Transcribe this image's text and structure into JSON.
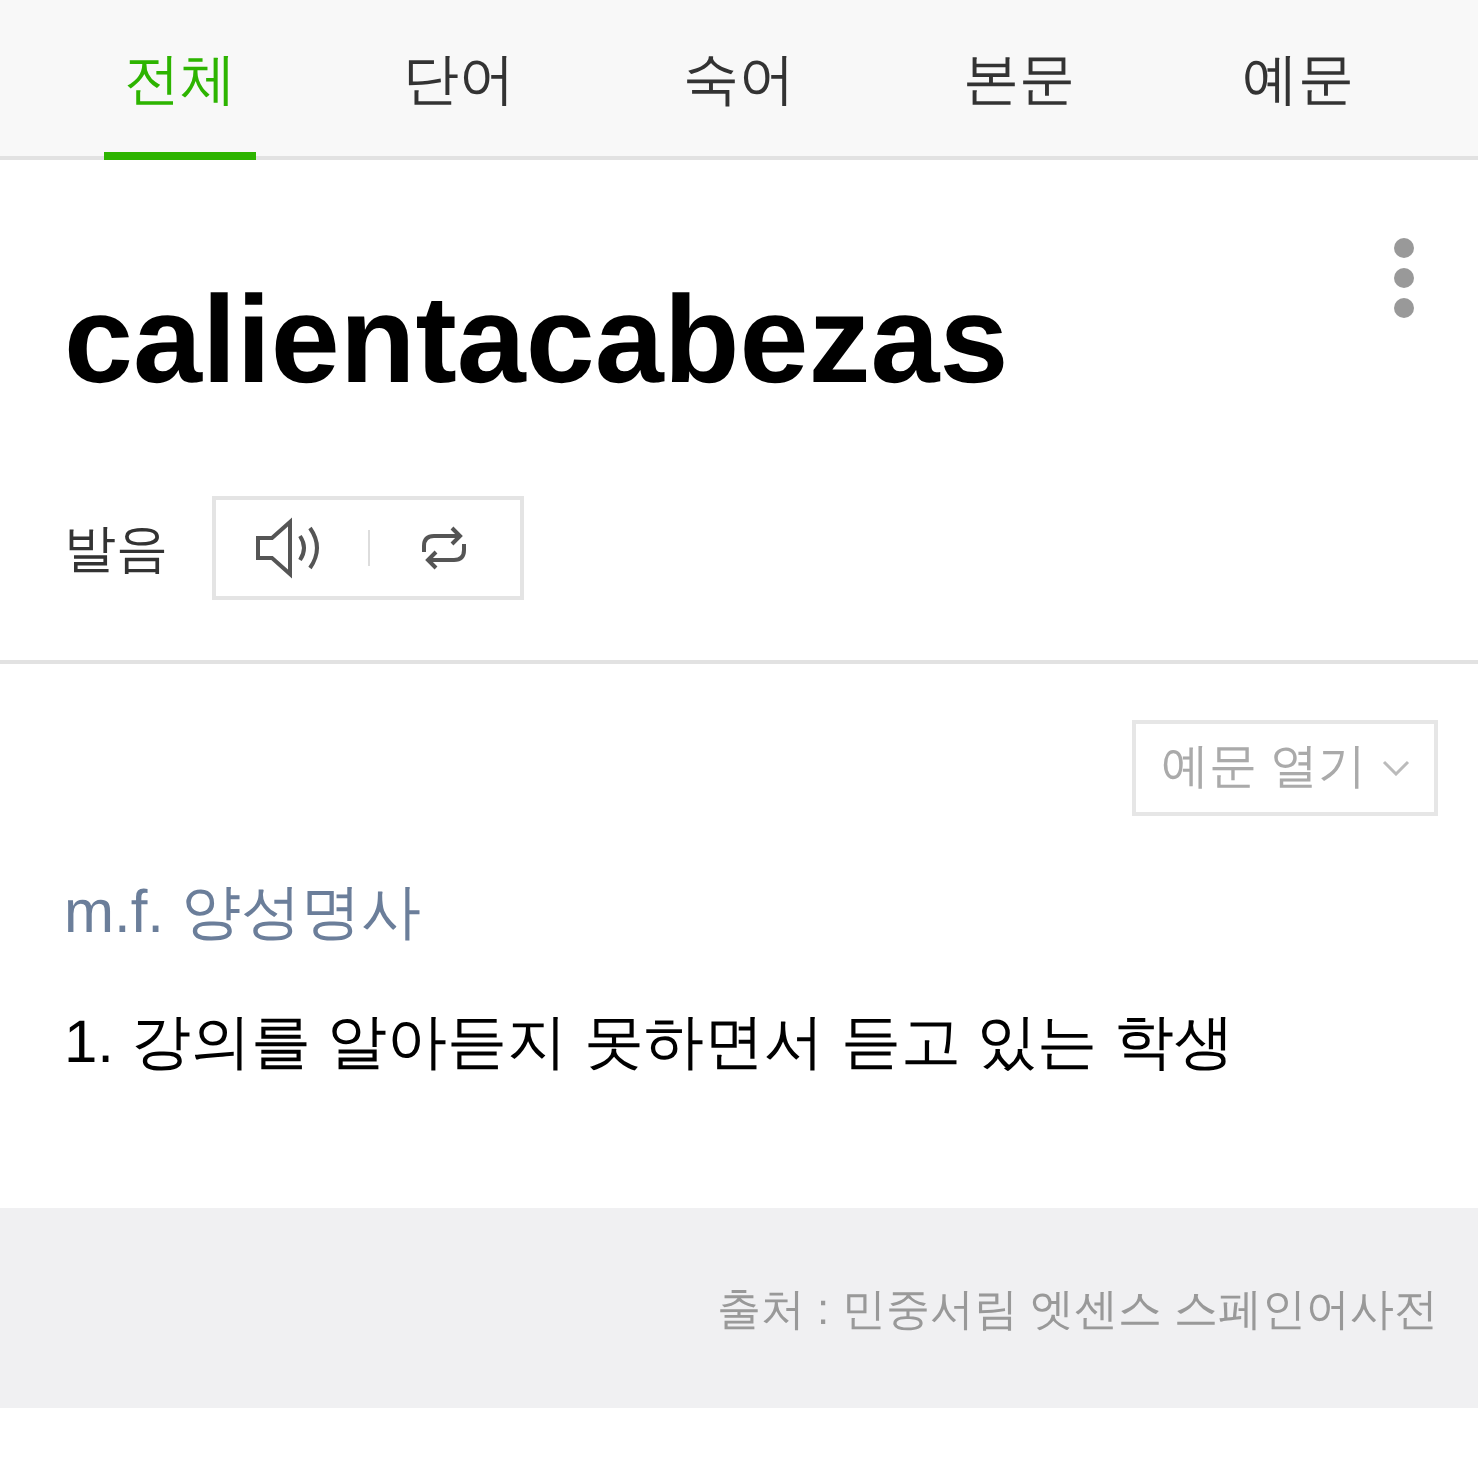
{
  "tabs": [
    {
      "label": "전체",
      "selected": true
    },
    {
      "label": "단어",
      "selected": false
    },
    {
      "label": "숙어",
      "selected": false
    },
    {
      "label": "본문",
      "selected": false
    },
    {
      "label": "예문",
      "selected": false
    }
  ],
  "entry": {
    "headword": "calientacabezas",
    "pronunciation_label": "발음"
  },
  "examples_toggle": {
    "label": "예문 열기"
  },
  "part_of_speech": "m.f. 양성명사",
  "definitions": [
    "1. 강의를 알아듣지 못하면서 듣고 있는 학생"
  ],
  "source": "출처 : 민중서림 엣센스 스페인어사전"
}
